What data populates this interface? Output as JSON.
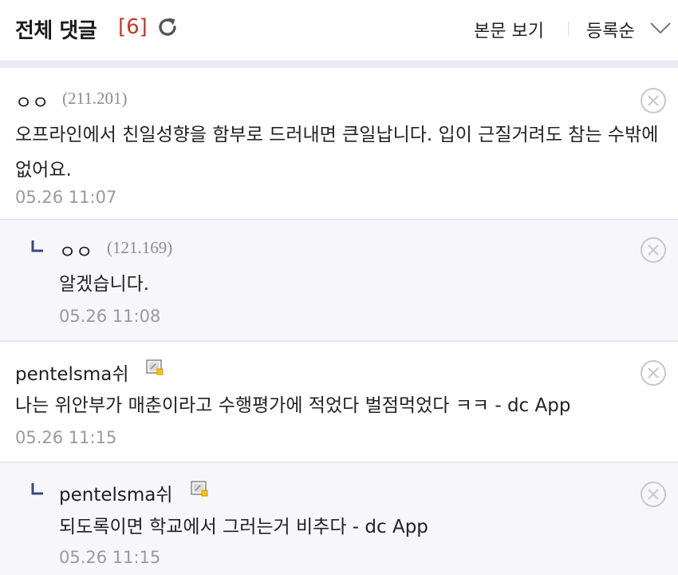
{
  "header": {
    "title": "전체 댓글",
    "count": "[6]",
    "view_post_label": "본문 보기",
    "sort_label": "등록순",
    "accent_color": "#c0392b"
  },
  "comments": [
    {
      "nickname": "ㅇㅇ",
      "ip": "(211.201)",
      "text": "오프라인에서 친일성향을 함부로 드러내면 큰일납니다. 입이 근질거려도 참는 수밖에 없어요.",
      "date": "05.26 11:07",
      "is_reply": false
    },
    {
      "nickname": "ㅇㅇ",
      "ip": "(121.169)",
      "text": "알겠습니다.",
      "date": "05.26 11:08",
      "is_reply": true
    },
    {
      "nickname": "pentelsma쉬",
      "icon": "gallog-icon",
      "text": "나는 위안부가 매춘이라고 수행평가에 적었다 벌점먹었다 ㅋㅋ - dc App",
      "date": "05.26 11:15",
      "is_reply": false
    },
    {
      "nickname": "pentelsma쉬",
      "icon": "gallog-icon",
      "text": "되도록이면 학교에서 그러는거 비추다 - dc App",
      "date": "05.26 11:15",
      "is_reply": true
    }
  ]
}
